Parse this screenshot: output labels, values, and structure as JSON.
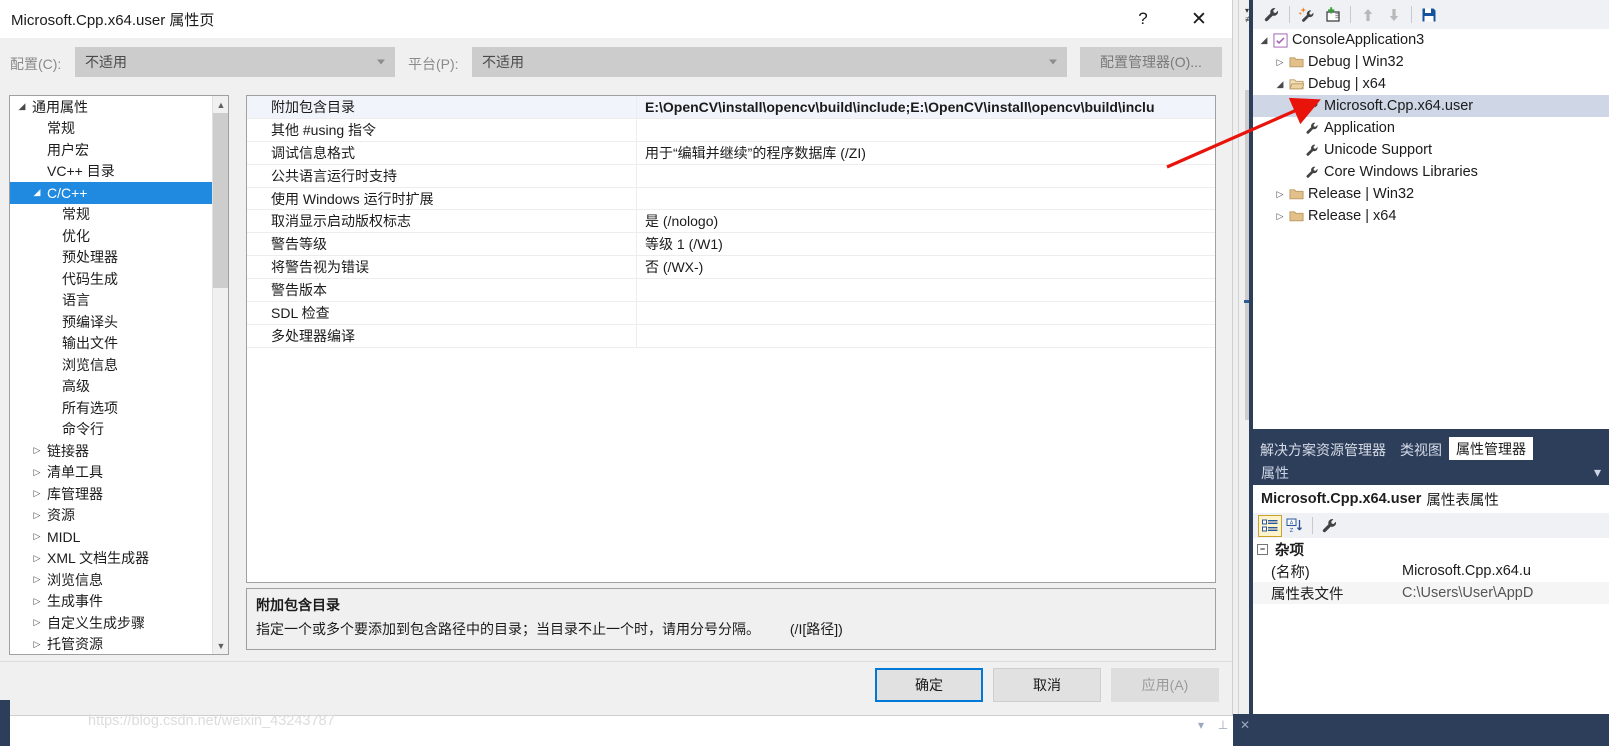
{
  "dialog": {
    "title": "Microsoft.Cpp.x64.user 属性页",
    "help_label": "?",
    "close_label": "✕",
    "config": {
      "config_label": "配置(C):",
      "config_value": "不适用",
      "platform_label": "平台(P):",
      "platform_value": "不适用",
      "manager_button": "配置管理器(O)..."
    },
    "nav": [
      {
        "label": "通用属性",
        "indent": 0,
        "twisty": "expanded",
        "selected": false
      },
      {
        "label": "常规",
        "indent": 1,
        "twisty": "none",
        "selected": false
      },
      {
        "label": "用户宏",
        "indent": 1,
        "twisty": "none",
        "selected": false
      },
      {
        "label": "VC++ 目录",
        "indent": 1,
        "twisty": "none",
        "selected": false
      },
      {
        "label": "C/C++",
        "indent": 1,
        "twisty": "expanded",
        "selected": true
      },
      {
        "label": "常规",
        "indent": 2,
        "twisty": "none",
        "selected": false
      },
      {
        "label": "优化",
        "indent": 2,
        "twisty": "none",
        "selected": false
      },
      {
        "label": "预处理器",
        "indent": 2,
        "twisty": "none",
        "selected": false
      },
      {
        "label": "代码生成",
        "indent": 2,
        "twisty": "none",
        "selected": false
      },
      {
        "label": "语言",
        "indent": 2,
        "twisty": "none",
        "selected": false
      },
      {
        "label": "预编译头",
        "indent": 2,
        "twisty": "none",
        "selected": false
      },
      {
        "label": "输出文件",
        "indent": 2,
        "twisty": "none",
        "selected": false
      },
      {
        "label": "浏览信息",
        "indent": 2,
        "twisty": "none",
        "selected": false
      },
      {
        "label": "高级",
        "indent": 2,
        "twisty": "none",
        "selected": false
      },
      {
        "label": "所有选项",
        "indent": 2,
        "twisty": "none",
        "selected": false
      },
      {
        "label": "命令行",
        "indent": 2,
        "twisty": "none",
        "selected": false
      },
      {
        "label": "链接器",
        "indent": 1,
        "twisty": "collapsed",
        "selected": false
      },
      {
        "label": "清单工具",
        "indent": 1,
        "twisty": "collapsed",
        "selected": false
      },
      {
        "label": "库管理器",
        "indent": 1,
        "twisty": "collapsed",
        "selected": false
      },
      {
        "label": "资源",
        "indent": 1,
        "twisty": "collapsed",
        "selected": false
      },
      {
        "label": "MIDL",
        "indent": 1,
        "twisty": "collapsed",
        "selected": false
      },
      {
        "label": "XML 文档生成器",
        "indent": 1,
        "twisty": "collapsed",
        "selected": false
      },
      {
        "label": "浏览信息",
        "indent": 1,
        "twisty": "collapsed",
        "selected": false
      },
      {
        "label": "生成事件",
        "indent": 1,
        "twisty": "collapsed",
        "selected": false
      },
      {
        "label": "自定义生成步骤",
        "indent": 1,
        "twisty": "collapsed",
        "selected": false
      },
      {
        "label": "托管资源",
        "indent": 1,
        "twisty": "collapsed",
        "selected": false
      }
    ],
    "grid": [
      {
        "name": "附加包含目录",
        "value": "E:\\OpenCV\\install\\opencv\\build\\include;E:\\OpenCV\\install\\opencv\\build\\inclu",
        "selected": true
      },
      {
        "name": "其他 #using 指令",
        "value": "",
        "selected": false
      },
      {
        "name": "调试信息格式",
        "value": "用于“编辑并继续”的程序数据库 (/ZI)",
        "selected": false
      },
      {
        "name": "公共语言运行时支持",
        "value": "",
        "selected": false
      },
      {
        "name": "使用 Windows 运行时扩展",
        "value": "",
        "selected": false
      },
      {
        "name": "取消显示启动版权标志",
        "value": "是 (/nologo)",
        "selected": false
      },
      {
        "name": "警告等级",
        "value": "等级 1 (/W1)",
        "selected": false
      },
      {
        "name": "将警告视为错误",
        "value": "否 (/WX-)",
        "selected": false
      },
      {
        "name": "警告版本",
        "value": "",
        "selected": false
      },
      {
        "name": "SDL 检查",
        "value": "",
        "selected": false
      },
      {
        "name": "多处理器编译",
        "value": "",
        "selected": false
      }
    ],
    "description": {
      "title": "附加包含目录",
      "body": "指定一个或多个要添加到包含路径中的目录；当目录不止一个时，请用分号分隔。",
      "flag": "(/I[路径])"
    },
    "buttons": {
      "ok": "确定",
      "cancel": "取消",
      "apply": "应用(A)"
    }
  },
  "property_manager": {
    "toolbar_icons": [
      "wrench-icon",
      "add-property-sheet-icon",
      "new-project-property-sheet-icon",
      "move-up-icon",
      "move-down-icon",
      "save-icon"
    ],
    "tree": [
      {
        "label": "ConsoleApplication3",
        "indent": 0,
        "twisty": "expanded",
        "icon": "solution-icon",
        "selected": false
      },
      {
        "label": "Debug | Win32",
        "indent": 1,
        "twisty": "collapsed",
        "icon": "folder-icon",
        "selected": false
      },
      {
        "label": "Debug | x64",
        "indent": 1,
        "twisty": "expanded",
        "icon": "folder-open-icon",
        "selected": false
      },
      {
        "label": "Microsoft.Cpp.x64.user",
        "indent": 2,
        "twisty": "none",
        "icon": "wrench-icon",
        "selected": true
      },
      {
        "label": "Application",
        "indent": 2,
        "twisty": "none",
        "icon": "wrench-icon",
        "selected": false
      },
      {
        "label": "Unicode Support",
        "indent": 2,
        "twisty": "none",
        "icon": "wrench-icon",
        "selected": false
      },
      {
        "label": "Core Windows Libraries",
        "indent": 2,
        "twisty": "none",
        "icon": "wrench-icon",
        "selected": false
      },
      {
        "label": "Release | Win32",
        "indent": 1,
        "twisty": "collapsed",
        "icon": "folder-icon",
        "selected": false
      },
      {
        "label": "Release | x64",
        "indent": 1,
        "twisty": "collapsed",
        "icon": "folder-icon",
        "selected": false
      }
    ],
    "tabs": [
      {
        "label": "解决方案资源管理器",
        "active": false
      },
      {
        "label": "类视图",
        "active": false
      },
      {
        "label": "属性管理器",
        "active": true
      }
    ]
  },
  "properties_window": {
    "header": "属性",
    "header_chevron": "▾",
    "object_name": "Microsoft.Cpp.x64.user",
    "object_kind": "属性表属性",
    "toolbar_icons": [
      "categorized-icon",
      "alphabetical-icon",
      "property-pages-icon"
    ],
    "category": "杂项",
    "category_expander": "−",
    "rows": [
      {
        "key": "(名称)",
        "value": "Microsoft.Cpp.x64.u"
      },
      {
        "key": "属性表文件",
        "value": "C:\\Users\\User\\AppD"
      }
    ]
  },
  "watermark": "https://blog.csdn.net/weixin_43243787",
  "colors": {
    "nav_selection": "#1f8ae0",
    "grid_selection": "#f1f5fb",
    "dock_chrome": "#2d3e5b",
    "ok_button_focus": "#0078d7",
    "arrow_annotation": "#e8140c"
  }
}
